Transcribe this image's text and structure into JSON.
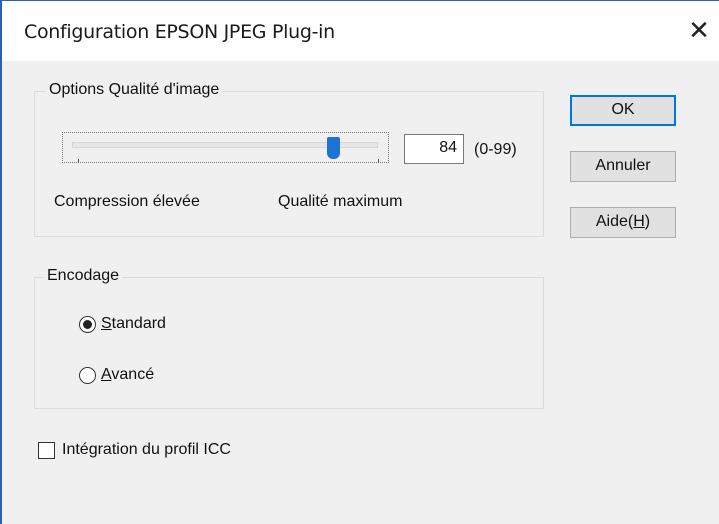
{
  "window": {
    "title": "Configuration EPSON JPEG Plug-in",
    "close_glyph": "✕"
  },
  "quality_group": {
    "label": "Options Qualité d'image",
    "slider_value": 84,
    "slider_min": 0,
    "slider_max": 99,
    "value_text": "84",
    "range_text": "(0-99)",
    "left_caption": "Compression élevée",
    "right_caption": "Qualité maximum"
  },
  "encoding_group": {
    "label": "Encodage",
    "options": [
      {
        "mnemonic": "S",
        "rest": "tandard",
        "selected": true
      },
      {
        "mnemonic": "A",
        "rest": "vancé",
        "selected": false
      }
    ]
  },
  "icc_checkbox": {
    "label": "Intégration du profil ICC",
    "checked": false
  },
  "buttons": {
    "ok": "OK",
    "cancel": "Annuler",
    "help_prefix": "Aide(",
    "help_mnemonic": "H",
    "help_suffix": ")"
  }
}
